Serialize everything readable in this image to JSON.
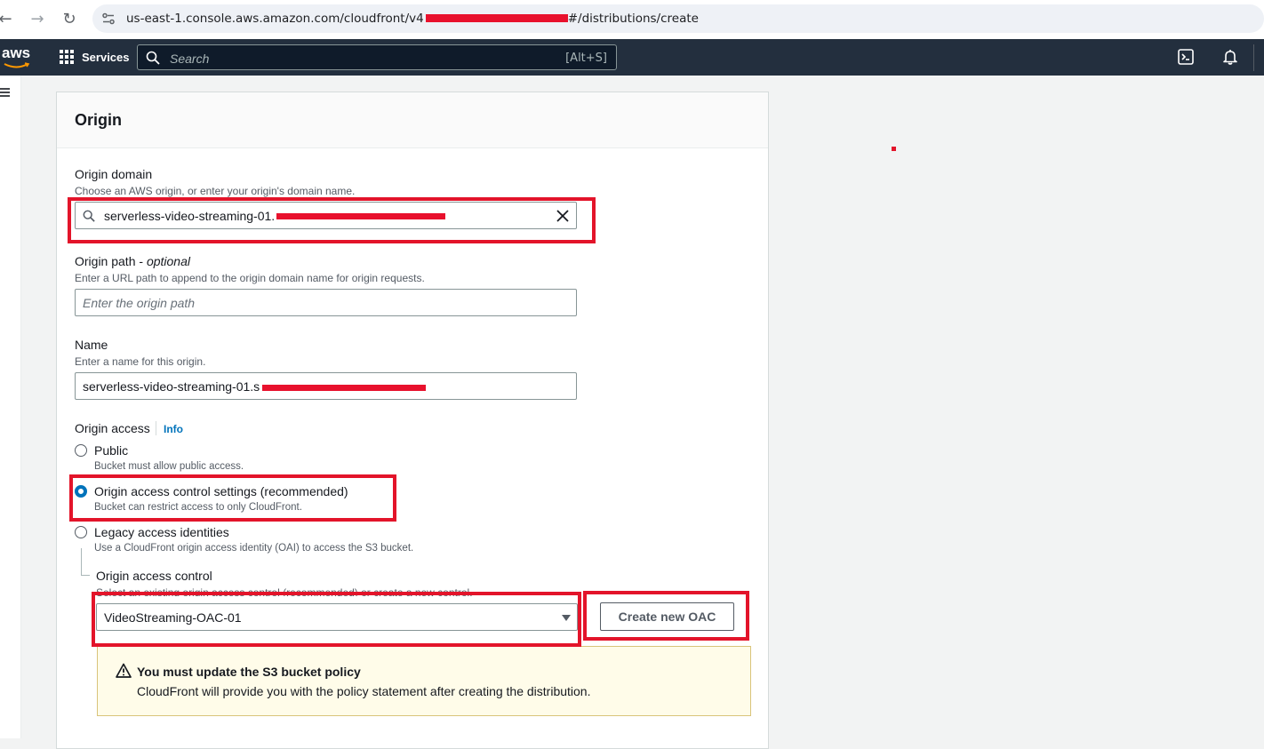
{
  "browser": {
    "url_prefix": "us-east-1.console.aws.amazon.com/cloudfront/v4",
    "url_suffix": "#/distributions/create"
  },
  "topnav": {
    "logo": "aws",
    "services_label": "Services",
    "search_placeholder": "Search",
    "search_shortcut": "[Alt+S]"
  },
  "origin_panel": {
    "title": "Origin",
    "origin_domain": {
      "label": "Origin domain",
      "description": "Choose an AWS origin, or enter your origin's domain name.",
      "value": "serverless-video-streaming-01."
    },
    "origin_path": {
      "label": "Origin path - ",
      "label_optional": "optional",
      "description": "Enter a URL path to append to the origin domain name for origin requests.",
      "placeholder": "Enter the origin path"
    },
    "name": {
      "label": "Name",
      "description": "Enter a name for this origin.",
      "value": "serverless-video-streaming-01.s"
    },
    "origin_access": {
      "label": "Origin access",
      "info": "Info",
      "options": [
        {
          "label": "Public",
          "description": "Bucket must allow public access.",
          "selected": false
        },
        {
          "label": "Origin access control settings (recommended)",
          "description": "Bucket can restrict access to only CloudFront.",
          "selected": true
        },
        {
          "label": "Legacy access identities",
          "description": "Use a CloudFront origin access identity (OAI) to access the S3 bucket.",
          "selected": false
        }
      ]
    },
    "origin_access_control": {
      "label": "Origin access control",
      "description": "Select an existing origin access control (recommended) or create a new control.",
      "selected": "VideoStreaming-OAC-01",
      "create_button": "Create new OAC"
    },
    "alert": {
      "title": "You must update the S3 bucket policy",
      "text": "CloudFront will provide you with the policy statement after creating the distribution."
    }
  },
  "colors": {
    "aws_nav": "#232f3e",
    "link": "#0073bb",
    "annotation": "#e3142a",
    "alert_bg": "#fffce9"
  }
}
